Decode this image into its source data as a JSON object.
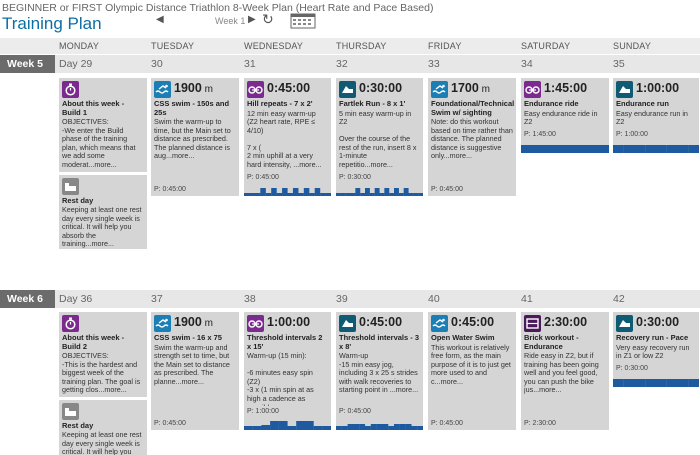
{
  "header": {
    "plan_name": "BEGINNER or FIRST Olympic Distance Triathlon 8-Week Plan (Heart Rate and Pace Based)",
    "page_title": "Training Plan",
    "week_label": "Week 1"
  },
  "days": [
    "MONDAY",
    "TUESDAY",
    "WEDNESDAY",
    "THURSDAY",
    "FRIDAY",
    "SATURDAY",
    "SUNDAY"
  ],
  "colors": {
    "swim": "#1b7fb5",
    "bike": "#7b2b8e",
    "run": "#0e5b73",
    "strength": "#4b1a5a",
    "info": "#7b2b8e",
    "rest": "#d9d9d9",
    "chart": "#1e5aa0"
  },
  "weeks": [
    {
      "label": "Week 5",
      "day_numbers": [
        "Day 29",
        "30",
        "31",
        "32",
        "33",
        "34",
        "35"
      ],
      "cards": [
        {
          "icon": "about-icon",
          "duration": "",
          "unit": "",
          "title": "About this week - Build 1",
          "desc": "OBJECTIVES:\n-We enter the Build phase of the training plan, which means that we add some moderat...more...",
          "p": ""
        },
        {
          "icon": "swim-icon",
          "duration": "1900",
          "unit": "m",
          "title": "CSS swim - 150s and 25s",
          "desc": "Swim the warm-up to time, but the Main set to distance as prescribed. The planned distance is aug...more...",
          "p": "P: 0:45:00"
        },
        {
          "icon": "bike-icon",
          "duration": "0:45:00",
          "unit": "",
          "title": "Hill repeats - 7 x 2'",
          "desc": "12 min easy warm-up (Z2 heart rate, RPE ≤ 4/10)\n\n7 x (\n2 min uphill at a very hard intensity, ...more...",
          "p": "P: 0:45:00"
        },
        {
          "icon": "run-icon",
          "duration": "0:30:00",
          "unit": "",
          "title": "Fartlek Run - 8 x 1'",
          "desc": "5 min easy warm-up in Z2\n\nOver the course of the rest of the run, insert 8 x 1-minute repetitio...more...",
          "p": "P: 0:30:00"
        },
        {
          "icon": "swim-icon",
          "duration": "1700",
          "unit": "m",
          "title": "Foundational/Technical Swim w/ sighting",
          "desc": "Note: do this workout based on time rather than distance. The planned distance is suggestive only...more...",
          "p": "P: 0:45:00"
        },
        {
          "icon": "bike-icon",
          "duration": "1:45:00",
          "unit": "",
          "title": "Endurance ride",
          "desc": "Easy endurance ride in Z2",
          "p": "P: 1:45:00"
        },
        {
          "icon": "run-icon",
          "duration": "1:00:00",
          "unit": "",
          "title": "Endurance run",
          "desc": "Easy endurance run in Z2",
          "p": "P: 1:00:00"
        }
      ],
      "rest": {
        "title": "Rest day",
        "desc": "Keeping at least one rest day every single week is critical. It will help you absorb the training...more..."
      }
    },
    {
      "label": "Week 6",
      "day_numbers": [
        "Day 36",
        "37",
        "38",
        "39",
        "40",
        "41",
        "42"
      ],
      "cards": [
        {
          "icon": "about-icon",
          "duration": "",
          "unit": "",
          "title": "About this week - Build 2",
          "desc": "OBJECTIVES:\n-This is the hardest and biggest week of the training plan. The goal is getting clos...more...",
          "p": ""
        },
        {
          "icon": "swim-icon",
          "duration": "1900",
          "unit": "m",
          "title": "CSS swim - 16 x 75",
          "desc": "Swim the warm-up and strength set to time, but the Main set to distance as prescribed. The planne...more...",
          "p": "P: 0:45:00"
        },
        {
          "icon": "bike-icon",
          "duration": "1:00:00",
          "unit": "",
          "title": "Threshold intervals 2 x 15'",
          "desc": "Warm-up (15 min):\n\n-6 minutes easy spin (Z2)\n-3 x (1 min spin at as high a cadence as possible...more...",
          "p": "P: 1:00:00"
        },
        {
          "icon": "run-icon",
          "duration": "0:45:00",
          "unit": "",
          "title": "Threshold intervals - 3 x 8'",
          "desc": "Warm-up\n-15 min easy jog, including 3 x 25 s strides with walk recoveries to starting point in ...more...",
          "p": "P: 0:45:00"
        },
        {
          "icon": "swim-icon",
          "duration": "0:45:00",
          "unit": "",
          "title": "Open Water Swim",
          "desc": "This workout is relatively free form, as the main purpose of it is to just get more used to and c...more...",
          "p": "P: 0:45:00"
        },
        {
          "icon": "brick-icon",
          "duration": "2:30:00",
          "unit": "",
          "title": "Brick workout - Endurance",
          "desc": "Ride easy in Z2, but if training has been going well and you feel good, you can push the bike jus...more...",
          "p": "P: 2:30:00"
        },
        {
          "icon": "run-icon",
          "duration": "0:30:00",
          "unit": "",
          "title": "Recovery run - Pace",
          "desc": "Very easy recovery run in Z1 or low Z2",
          "p": "P: 0:30:00"
        }
      ],
      "rest": {
        "title": "Rest day",
        "desc": "Keeping at least one rest day every single week is critical. It will help you"
      }
    }
  ]
}
